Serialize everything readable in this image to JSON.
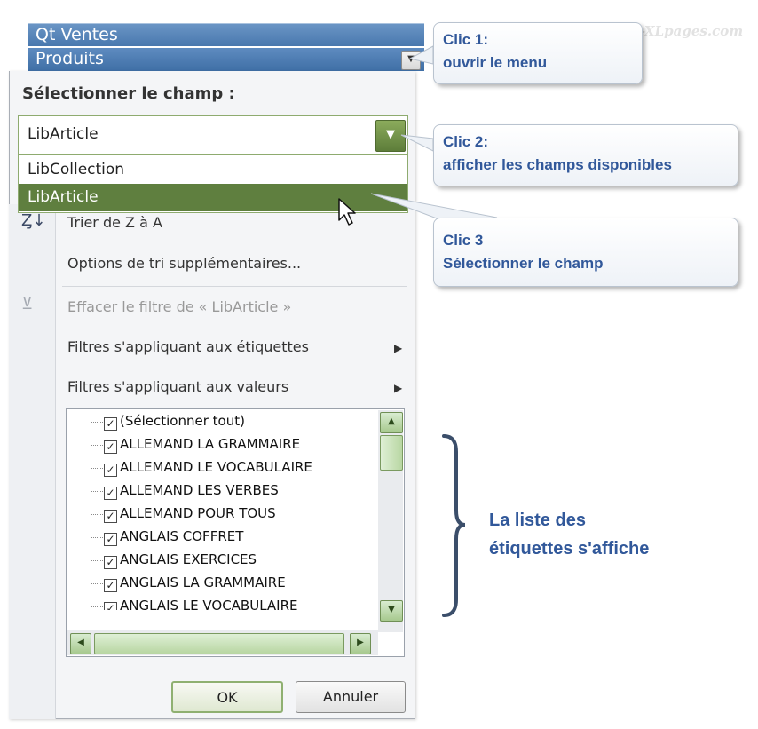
{
  "header": {
    "row1": "Qt Ventes",
    "row2": "Produits"
  },
  "watermark": "mDF-XLpages.com",
  "panel": {
    "section_title": "Sélectionner le champ :",
    "combo_value": "LibArticle",
    "options": [
      "LibCollection",
      "LibArticle"
    ],
    "menu": {
      "sort_za": "Trier de Z à A",
      "more_sort": "Options de tri supplémentaires...",
      "clear_filter": "Effacer le filtre de « LibArticle »",
      "label_filters": "Filtres s'appliquant aux étiquettes",
      "value_filters": "Filtres s'appliquant aux valeurs"
    },
    "checklist": [
      "(Sélectionner tout)",
      "ALLEMAND LA GRAMMAIRE",
      "ALLEMAND LE VOCABULAIRE",
      "ALLEMAND LES VERBES",
      "ALLEMAND POUR TOUS",
      "ANGLAIS COFFRET",
      "ANGLAIS EXERCICES",
      "ANGLAIS LA GRAMMAIRE",
      "ANGLAIS LE VOCABULAIRE"
    ],
    "ok_label": "OK",
    "cancel_label": "Annuler"
  },
  "callouts": {
    "c1_line1": "Clic 1:",
    "c1_line2": "ouvrir le menu",
    "c2_line1": "Clic 2:",
    "c2_line2": "afficher les champs disponibles",
    "c3_line1": "Clic 3",
    "c3_line2": "Sélectionner le champ"
  },
  "note": {
    "line1": "La liste des",
    "line2": "étiquettes s'affiche"
  },
  "colors": {
    "header_blue": "#4978ae",
    "selected_green": "#5f7f3f",
    "callout_text": "#31589a"
  }
}
